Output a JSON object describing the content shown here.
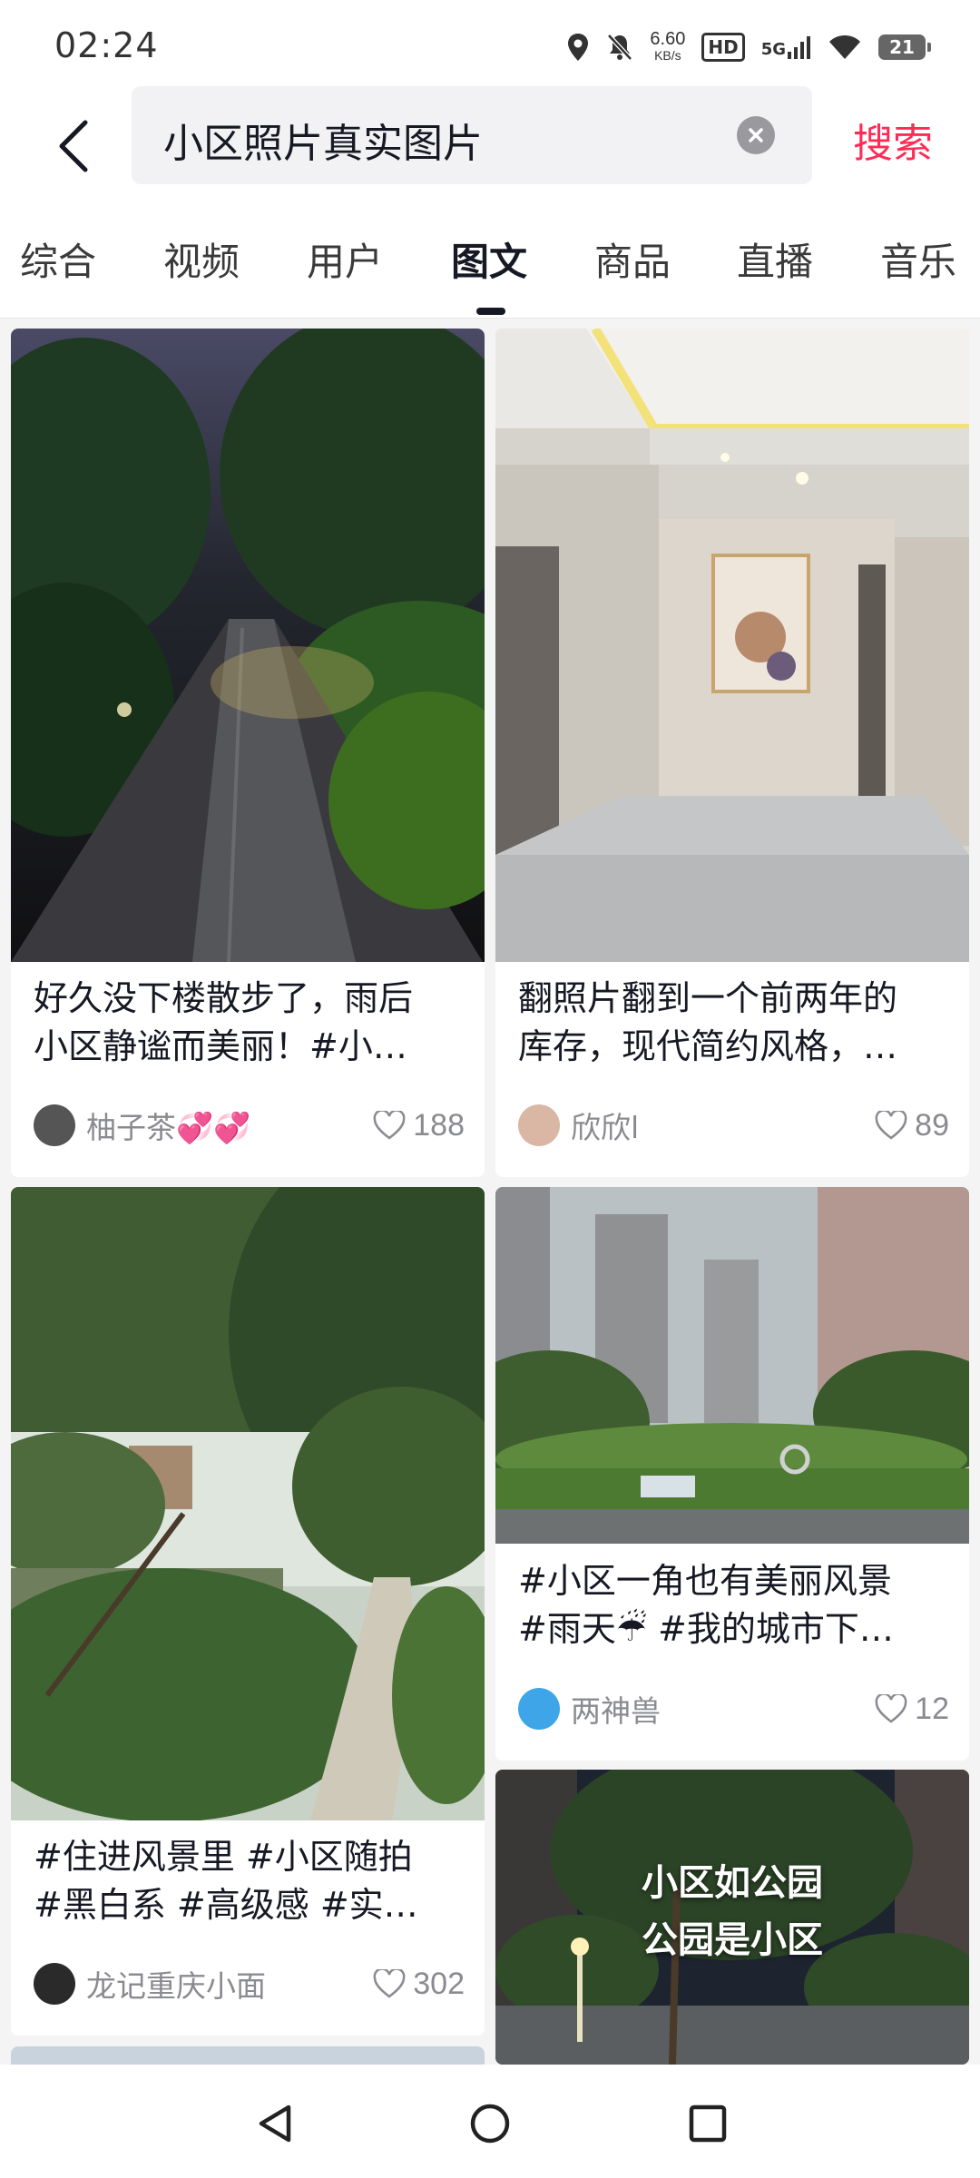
{
  "status_bar": {
    "time": "02:24",
    "speed_value": "6.60",
    "speed_unit": "KB/s",
    "hd": "HD",
    "network": "5G",
    "battery": "21"
  },
  "search": {
    "query": "小区照片真实图片",
    "search_label": "搜索"
  },
  "tabs": [
    {
      "label": "综合"
    },
    {
      "label": "视频"
    },
    {
      "label": "用户"
    },
    {
      "label": "图文"
    },
    {
      "label": "商品"
    },
    {
      "label": "直播"
    },
    {
      "label": "音乐"
    }
  ],
  "active_tab": "图文",
  "posts": [
    {
      "title_line1": "好久没下楼散步了，雨后",
      "title_line2": "小区静谧而美丽！#小…",
      "author": "柚子茶💞💞",
      "likes": "188"
    },
    {
      "title_line1": "翻照片翻到一个前两年的",
      "title_line2": "库存，现代简约风格，…",
      "author": "欣欣l",
      "likes": "89"
    },
    {
      "title_line1": "#住进风景里 #小区随拍",
      "title_line2": "#黑白系 #高级感 #实…",
      "author": "龙记重庆小面",
      "likes": "302"
    },
    {
      "title_line1": "#小区一角也有美丽风景",
      "title_line2": "#雨天☔ #我的城市下…",
      "author": "两神兽",
      "likes": "12"
    },
    {
      "image_text_line1": "小区如公园",
      "image_text_line2": "公园是小区"
    }
  ],
  "colors": {
    "accent": "#fe2c55",
    "text_primary": "#161823",
    "text_secondary": "#8a8b91",
    "background": "#f4f4f4"
  }
}
